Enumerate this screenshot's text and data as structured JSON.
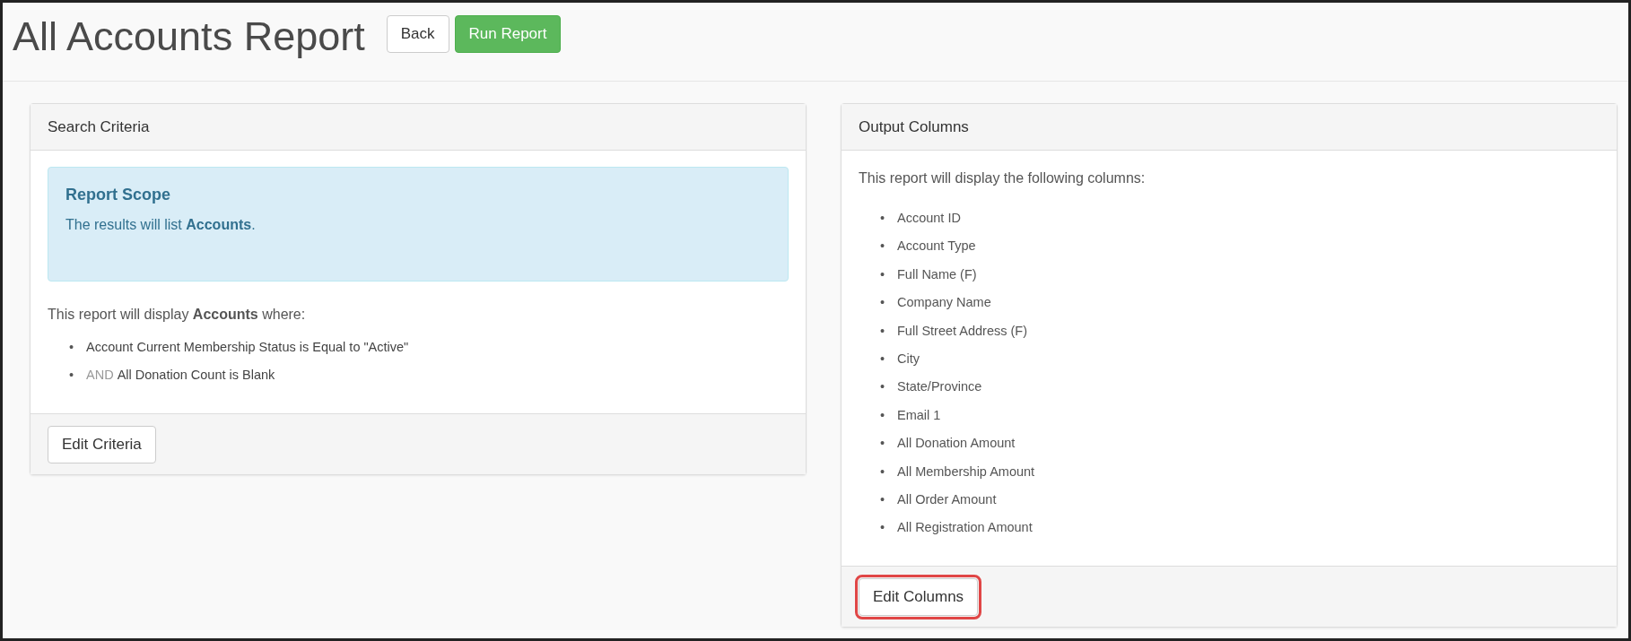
{
  "page": {
    "title": "All Accounts Report"
  },
  "header_buttons": [
    {
      "label": "Back",
      "kind": "default"
    },
    {
      "label": "Run Report",
      "kind": "success"
    }
  ],
  "search_criteria": {
    "heading": "Search Criteria",
    "alert": {
      "title": "Report Scope",
      "text": "The results will list **Accounts**."
    },
    "intro": "This report will display **Accounts** where:",
    "conditions": [
      {
        "bullet": "•",
        "text": "Account Current Membership Status is Equal to \"Active\""
      },
      {
        "bullet": "•",
        "connector": "AND",
        "text": "All Donation Count is Blank"
      }
    ],
    "button": {
      "label": "Edit Criteria",
      "highlighted": false
    }
  },
  "output_columns": {
    "heading": "Output Columns",
    "intro": "This report will display the following columns:",
    "columns": [
      {
        "bullet": "•",
        "name": "Account ID"
      },
      {
        "bullet": "•",
        "name": "Account Type"
      },
      {
        "bullet": "•",
        "name": "Full Name (F)"
      },
      {
        "bullet": "•",
        "name": "Company Name"
      },
      {
        "bullet": "•",
        "name": "Full Street Address (F)"
      },
      {
        "bullet": "•",
        "name": "City"
      },
      {
        "bullet": "•",
        "name": "State/Province"
      },
      {
        "bullet": "•",
        "name": "Email 1"
      },
      {
        "bullet": "•",
        "name": "All Donation Amount"
      },
      {
        "bullet": "•",
        "name": "All Membership Amount"
      },
      {
        "bullet": "•",
        "name": "All Order Amount"
      },
      {
        "bullet": "•",
        "name": "All Registration Amount"
      }
    ],
    "button": {
      "label": "Edit Columns",
      "highlighted": true
    }
  }
}
